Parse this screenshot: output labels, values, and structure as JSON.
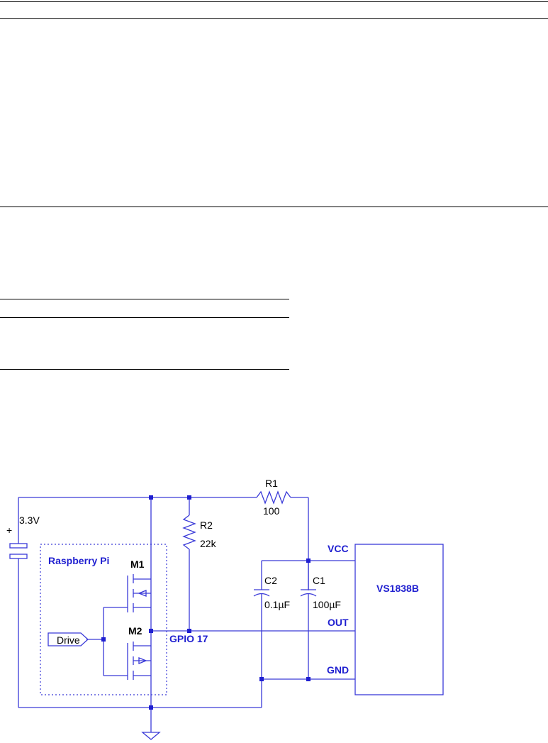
{
  "schematic": {
    "supply_label": "3.3V",
    "battery_plus": "+",
    "board_label": "Raspberry Pi",
    "drive_label": "Drive",
    "m1_label": "M1",
    "m2_label": "M2",
    "r1_name": "R1",
    "r1_value": "100",
    "r2_name": "R2",
    "r2_value": "22k",
    "c1_name": "C1",
    "c1_value": "100µF",
    "c2_name": "C2",
    "c2_value": "0.1µF",
    "gpio_label": "GPIO 17",
    "ic_name": "VS1838B",
    "pin_vcc": "VCC",
    "pin_out": "OUT",
    "pin_gnd": "GND"
  },
  "colors": {
    "wire": "#3a3ad8",
    "label_blue": "#1f1fd0",
    "text": "#000000"
  }
}
